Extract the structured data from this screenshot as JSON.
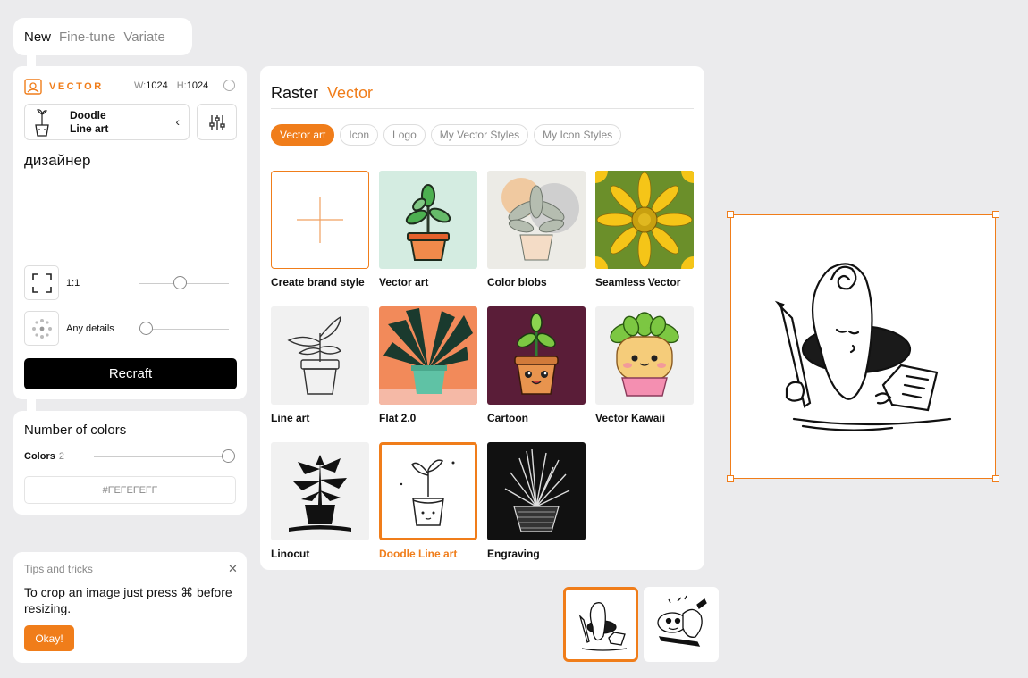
{
  "top_tabs": {
    "new": "New",
    "fine_tune": "Fine-tune",
    "variate": "Variate"
  },
  "left_panel": {
    "mode_label": "VECTOR",
    "width_label": "W:",
    "width_value": "1024",
    "height_label": "H:",
    "height_value": "1024",
    "style_line1": "Doodle",
    "style_line2": "Line art",
    "prompt": "дизайнер",
    "ratio_label": "1:1",
    "ratio_slider_fraction": 0.45,
    "details_label": "Any details",
    "details_slider_fraction": 0.0,
    "recraft_label": "Recraft"
  },
  "colors_panel": {
    "title": "Number of colors",
    "colors_label": "Colors",
    "colors_count": "2",
    "colors_slider_fraction": 1.0,
    "hex_value": "#FEFEFEFF"
  },
  "tips": {
    "title": "Tips and tricks",
    "text": "To crop an image just press ⌘ before resizing.",
    "ok_label": "Okay!"
  },
  "styles_panel": {
    "tab_raster": "Raster",
    "tab_vector": "Vector",
    "chips": [
      "Vector art",
      "Icon",
      "Logo",
      "My Vector Styles",
      "My Icon Styles"
    ],
    "active_chip": "Vector art",
    "tiles": [
      "Create brand style",
      "Vector art",
      "Color blobs",
      "Seamless Vector",
      "Line art",
      "Flat 2.0",
      "Cartoon",
      "Vector Kawaii",
      "Linocut",
      "Doodle Line art",
      "Engraving"
    ],
    "selected_tile": "Doodle Line art"
  },
  "colors": {
    "accent": "#f07d1a",
    "text": "#111111",
    "muted": "#888888",
    "background": "#ebebed"
  }
}
